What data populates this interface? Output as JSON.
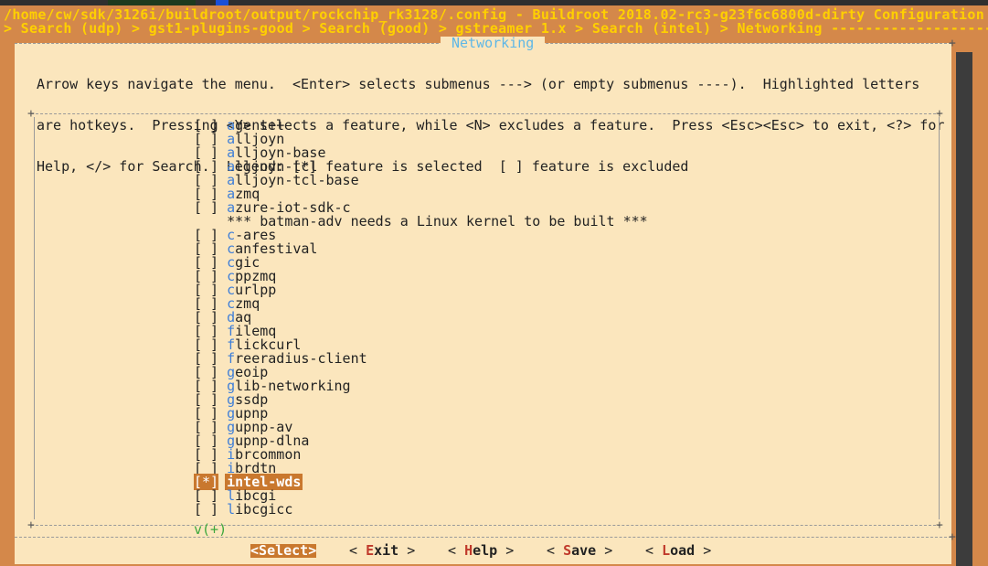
{
  "window": {
    "path_title": "/home/cw/sdk/3126i/buildroot/output/rockchip_rk3128/.config - Buildroot 2018.02-rc3-g23f6c6800d-dirty Configuration",
    "breadcrumb": "> Search (udp) > gst1-plugins-good > Search (good) > gstreamer 1.x > Search (intel) > Networking ---------------------"
  },
  "dialog": {
    "title": "Networking",
    "help_lines": [
      "Arrow keys navigate the menu.  <Enter> selects submenus ---> (or empty submenus ----).  Highlighted letters",
      "are hotkeys.  Pressing <Y> selects a feature, while <N> excludes a feature.  Press <Esc><Esc> to exit, <?> for",
      "Help, </> for Search.  Legend: [*] feature is selected  [ ] feature is excluded"
    ]
  },
  "menu": {
    "items": [
      {
        "box": "[ ]",
        "hotkey": "a",
        "rest": "gent++"
      },
      {
        "box": "[ ]",
        "hotkey": "a",
        "rest": "lljoyn"
      },
      {
        "box": "[ ]",
        "hotkey": "a",
        "rest": "lljoyn-base"
      },
      {
        "box": "[ ]",
        "hotkey": "a",
        "rest": "lljoyn-tcl"
      },
      {
        "box": "[ ]",
        "hotkey": "a",
        "rest": "lljoyn-tcl-base"
      },
      {
        "box": "[ ]",
        "hotkey": "a",
        "rest": "zmq"
      },
      {
        "box": "[ ]",
        "hotkey": "a",
        "rest": "zure-iot-sdk-c"
      },
      {
        "box": "   ",
        "hotkey": "",
        "rest": "*** batman-adv needs a Linux kernel to be built ***"
      },
      {
        "box": "[ ]",
        "hotkey": "c",
        "rest": "-ares"
      },
      {
        "box": "[ ]",
        "hotkey": "c",
        "rest": "anfestival"
      },
      {
        "box": "[ ]",
        "hotkey": "c",
        "rest": "gic"
      },
      {
        "box": "[ ]",
        "hotkey": "c",
        "rest": "ppzmq"
      },
      {
        "box": "[ ]",
        "hotkey": "c",
        "rest": "urlpp"
      },
      {
        "box": "[ ]",
        "hotkey": "c",
        "rest": "zmq"
      },
      {
        "box": "[ ]",
        "hotkey": "d",
        "rest": "aq"
      },
      {
        "box": "[ ]",
        "hotkey": "f",
        "rest": "ilemq"
      },
      {
        "box": "[ ]",
        "hotkey": "f",
        "rest": "lickcurl"
      },
      {
        "box": "[ ]",
        "hotkey": "f",
        "rest": "reeradius-client"
      },
      {
        "box": "[ ]",
        "hotkey": "g",
        "rest": "eoip"
      },
      {
        "box": "[ ]",
        "hotkey": "g",
        "rest": "lib-networking"
      },
      {
        "box": "[ ]",
        "hotkey": "g",
        "rest": "ssdp"
      },
      {
        "box": "[ ]",
        "hotkey": "g",
        "rest": "upnp"
      },
      {
        "box": "[ ]",
        "hotkey": "g",
        "rest": "upnp-av"
      },
      {
        "box": "[ ]",
        "hotkey": "g",
        "rest": "upnp-dlna"
      },
      {
        "box": "[ ]",
        "hotkey": "i",
        "rest": "brcommon"
      },
      {
        "box": "[ ]",
        "hotkey": "i",
        "rest": "brdtn"
      },
      {
        "box": "[*]",
        "hotkey": "i",
        "rest": "ntel-wds",
        "selected": true
      },
      {
        "box": "[ ]",
        "hotkey": "l",
        "rest": "ibcgi"
      },
      {
        "box": "[ ]",
        "hotkey": "l",
        "rest": "ibcgicc"
      }
    ],
    "more_indicator": "v(+)"
  },
  "buttons": [
    {
      "pre": "<",
      "hotkey": "S",
      "rest": "elect",
      "post": ">"
    },
    {
      "pre": "< ",
      "hotkey": "E",
      "rest": "xit",
      "post": " >"
    },
    {
      "pre": "< ",
      "hotkey": "H",
      "rest": "elp",
      "post": " >"
    },
    {
      "pre": "< ",
      "hotkey": "S",
      "rest": "ave",
      "post": " >"
    },
    {
      "pre": "< ",
      "hotkey": "L",
      "rest": "oad",
      "post": " >"
    }
  ]
}
